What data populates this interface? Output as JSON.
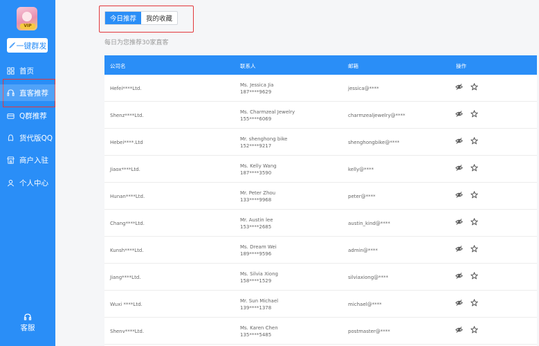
{
  "sidebar": {
    "avatar_badge": "VIP",
    "mass_send": "一键群发",
    "items": [
      {
        "label": "首页",
        "icon": "grid-icon"
      },
      {
        "label": "直客推荐",
        "icon": "headset-icon"
      },
      {
        "label": "Q群推荐",
        "icon": "group-icon"
      },
      {
        "label": "货代版QQ",
        "icon": "qq-icon"
      },
      {
        "label": "商户入驻",
        "icon": "store-icon"
      },
      {
        "label": "个人中心",
        "icon": "user-icon"
      }
    ],
    "active_index": 1,
    "service": "客服"
  },
  "tabs": {
    "items": [
      "今日推荐",
      "我的收藏"
    ],
    "active_index": 0
  },
  "subtitle": "每日为您推荐30家直客",
  "table": {
    "headers": {
      "company": "公司名",
      "contact": "联系人",
      "email": "邮箱",
      "ops": "操作"
    },
    "rows": [
      {
        "company": "Hefei****Ltd.",
        "contact_name": "Ms. Jessica Jia",
        "phone": "187****9629",
        "email": "jessica@****"
      },
      {
        "company": "Shenz****Ltd.",
        "contact_name": "Ms. Charmzeal Jewelry",
        "phone": "155****6069",
        "email": "charmzealjewelry@****"
      },
      {
        "company": "Hebei****.Ltd",
        "contact_name": "Mr. shenghong bike",
        "phone": "152****9217",
        "email": "shenghongbike@****"
      },
      {
        "company": "Jiaox****Ltd.",
        "contact_name": "Ms. Kelly Wang",
        "phone": "187****3590",
        "email": "kelly@****"
      },
      {
        "company": "Hunan****Ltd.",
        "contact_name": "Mr. Peter Zhou",
        "phone": "133****9968",
        "email": "peter@****"
      },
      {
        "company": "Chang****Ltd.",
        "contact_name": "Mr. Austin lee",
        "phone": "153****2685",
        "email": "austin_kind@****"
      },
      {
        "company": "Kunsh****Ltd.",
        "contact_name": "Ms. Dream Wei",
        "phone": "189****9596",
        "email": "admin@****"
      },
      {
        "company": "Jiang****Ltd.",
        "contact_name": "Ms. Silvia Xiong",
        "phone": "158****1529",
        "email": "silviaxiong@****"
      },
      {
        "company": "Wuxi ****Ltd.",
        "contact_name": "Mr. Sun Michael",
        "phone": "139****1378",
        "email": "michael@****"
      },
      {
        "company": "Shenv****Ltd.",
        "contact_name": "Ms. Karen Chen",
        "phone": "135****5485",
        "email": "postmaster@****"
      }
    ],
    "row_icons": [
      "eye-off-icon",
      "star-icon"
    ]
  },
  "colors": {
    "primary": "#2a8ef7",
    "highlight": "#e2363a"
  }
}
